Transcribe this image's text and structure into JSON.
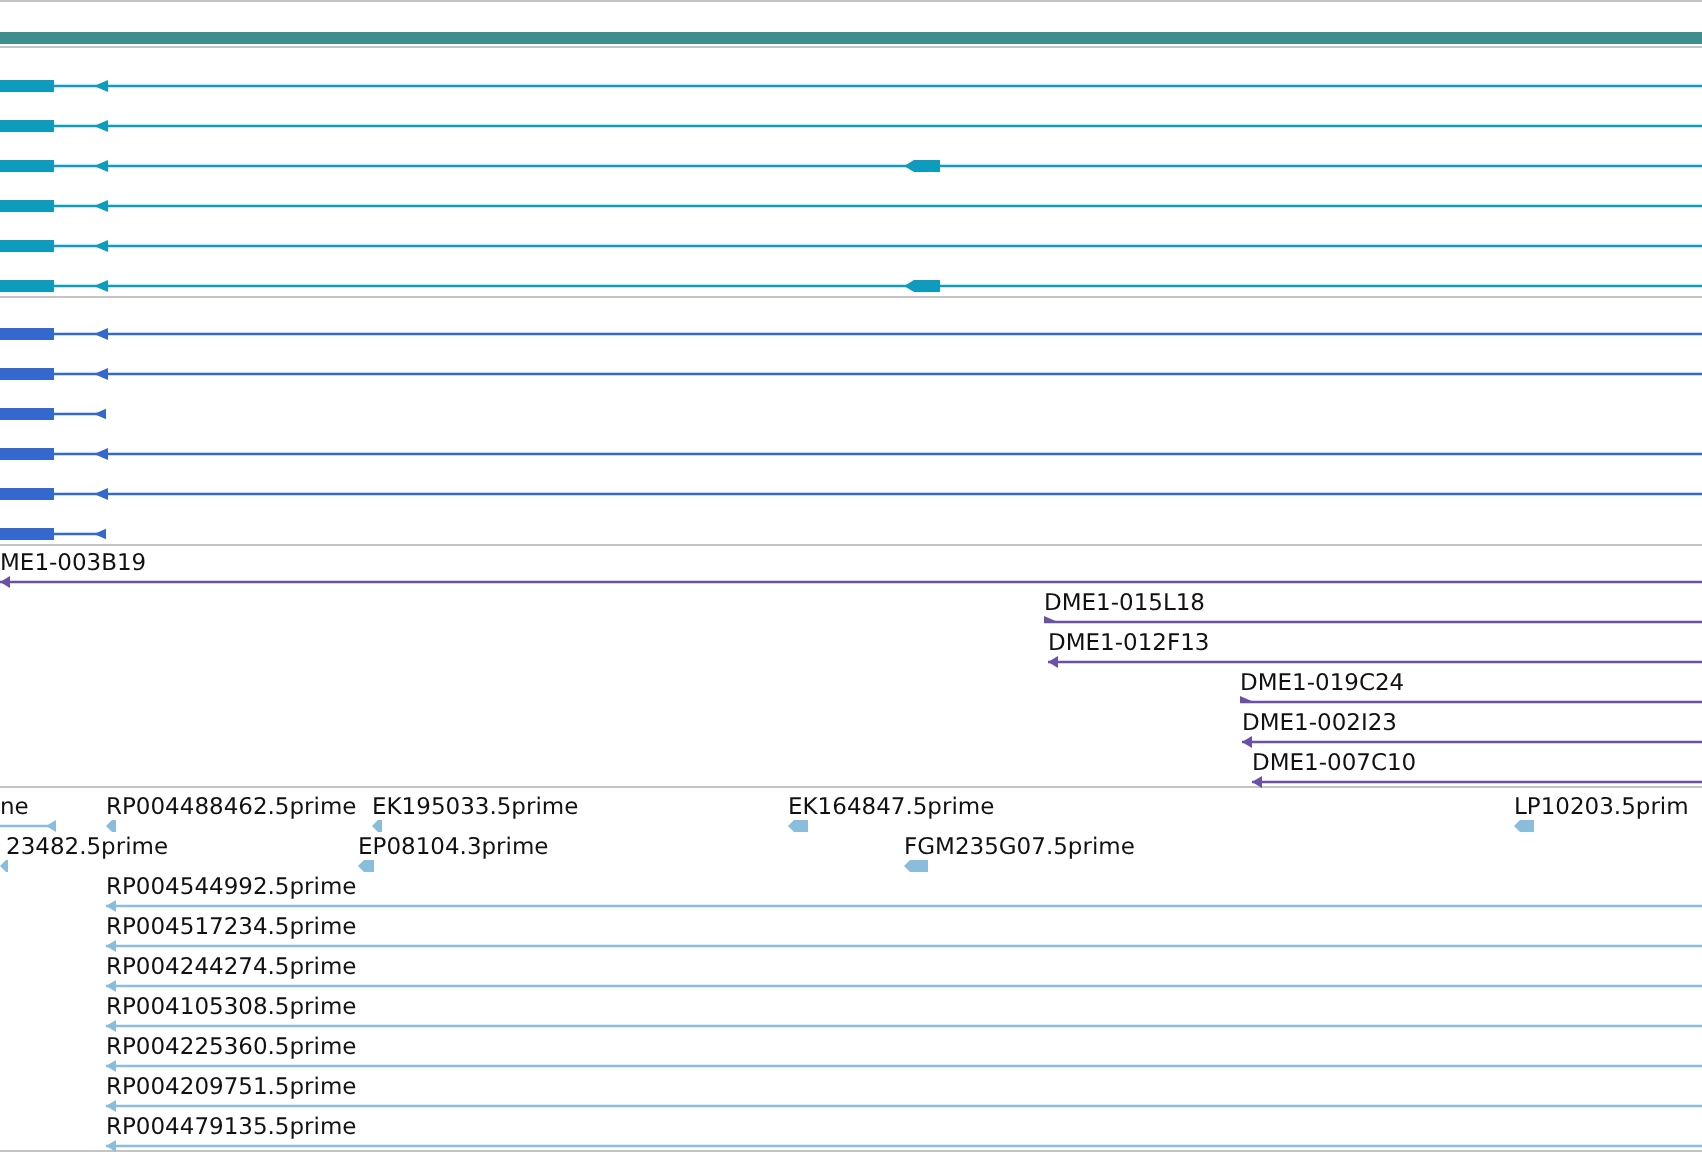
{
  "tracks": [
    {
      "kind": "transcripts",
      "color": "#0e9bbd",
      "rows": [
        {
          "kind": "single"
        },
        {
          "kind": "single"
        },
        {
          "kind": "two_exon"
        },
        {
          "kind": "single"
        },
        {
          "kind": "single"
        },
        {
          "kind": "two_exon"
        }
      ]
    },
    {
      "kind": "transcripts",
      "color": "#3468cc",
      "rows": [
        {
          "kind": "single"
        },
        {
          "kind": "single"
        },
        {
          "kind": "short"
        },
        {
          "kind": "single"
        },
        {
          "kind": "single"
        },
        {
          "kind": "short"
        }
      ]
    },
    {
      "kind": "features",
      "color": "#6a50a7",
      "rows": [
        {
          "items": [
            {
              "label": "ME1-003B19",
              "kind": "long",
              "forward": false
            }
          ]
        },
        {
          "items": [
            {
              "label": "DME1-015L18",
              "kind": "long",
              "forward": true
            }
          ]
        },
        {
          "items": [
            {
              "label": "DME1-012F13",
              "kind": "long",
              "forward": false
            }
          ]
        },
        {
          "items": [
            {
              "label": "DME1-019C24",
              "kind": "long",
              "forward": true
            }
          ]
        },
        {
          "items": [
            {
              "label": "DME1-002I23",
              "kind": "long",
              "forward": false
            }
          ]
        },
        {
          "items": [
            {
              "label": "DME1-007C10",
              "kind": "long",
              "forward": false
            }
          ]
        }
      ]
    },
    {
      "kind": "features",
      "color": "#8abcdc",
      "rows": [
        {
          "items": [
            {
              "label": "ne",
              "kind": "tail",
              "forward": false
            },
            {
              "label": "RP004488462.5prime",
              "kind": "short",
              "forward": false
            },
            {
              "label": "EK195033.5prime",
              "kind": "short",
              "forward": false
            },
            {
              "label": "EK164847.5prime",
              "kind": "short",
              "forward": false
            },
            {
              "label": "LP10203.5prim",
              "kind": "short",
              "forward": false
            }
          ]
        },
        {
          "items": [
            {
              "label": "23482.5prime",
              "kind": "short",
              "forward": false
            },
            {
              "label": "EP08104.3prime",
              "kind": "short",
              "forward": false
            },
            {
              "label": "FGM235G07.5prime",
              "kind": "short",
              "forward": false
            }
          ]
        },
        {
          "items": [
            {
              "label": "RP004544992.5prime",
              "kind": "long",
              "forward": false
            }
          ]
        },
        {
          "items": [
            {
              "label": "RP004517234.5prime",
              "kind": "long",
              "forward": false
            }
          ]
        },
        {
          "items": [
            {
              "label": "RP004244274.5prime",
              "kind": "long",
              "forward": false
            }
          ]
        },
        {
          "items": [
            {
              "label": "RP004105308.5prime",
              "kind": "long",
              "forward": false
            }
          ]
        },
        {
          "items": [
            {
              "label": "RP004225360.5prime",
              "kind": "long",
              "forward": false
            }
          ]
        },
        {
          "items": [
            {
              "label": "RP004209751.5prime",
              "kind": "long",
              "forward": false
            }
          ]
        },
        {
          "items": [
            {
              "label": "RP004479135.5prime",
              "kind": "long",
              "forward": false
            }
          ]
        }
      ]
    }
  ]
}
